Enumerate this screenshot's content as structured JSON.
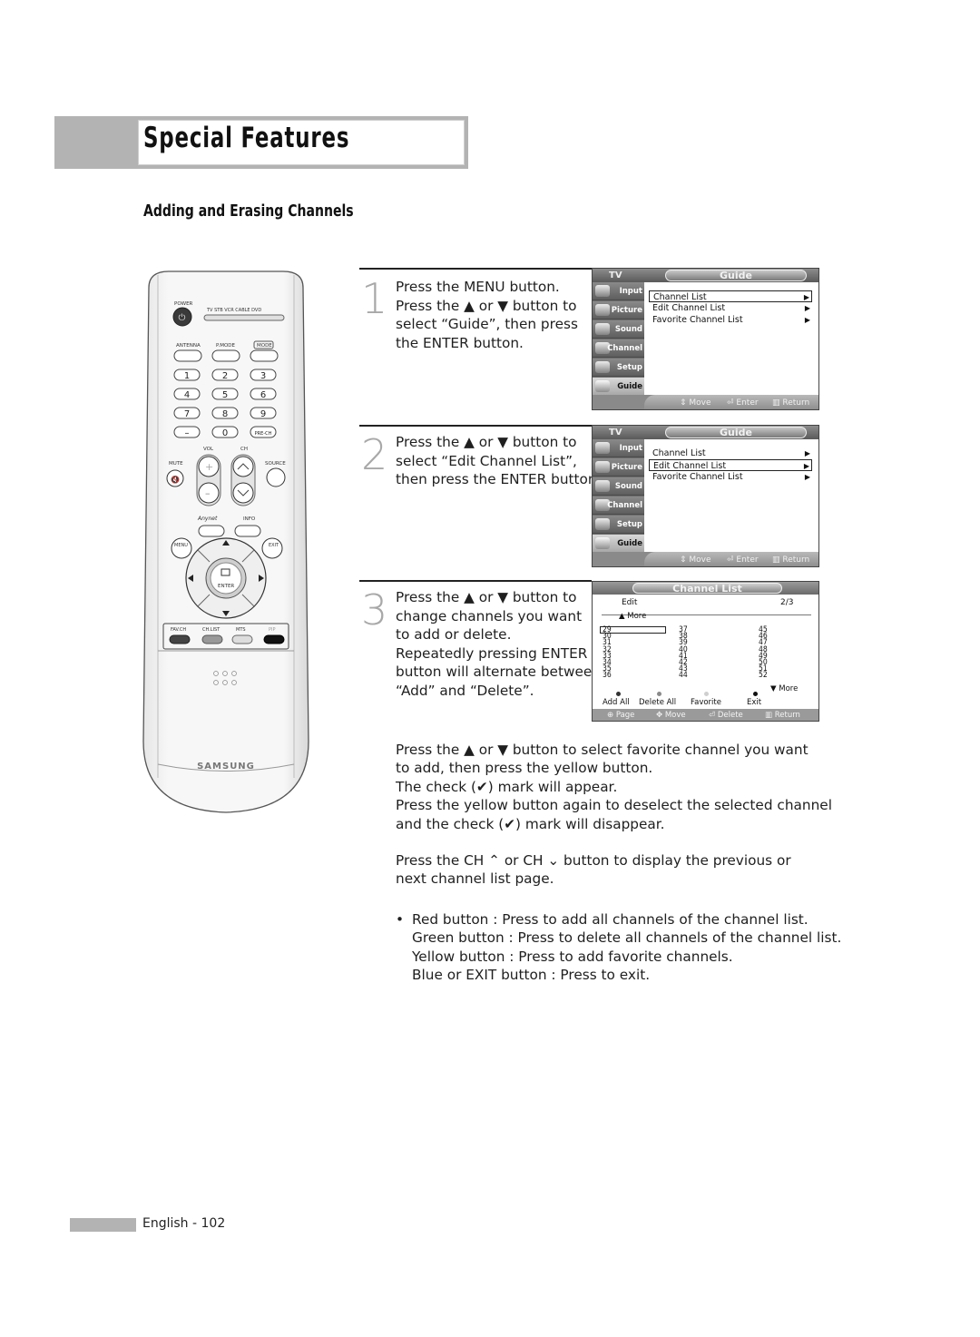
{
  "header": {
    "title": "Special Features",
    "section_title": "Adding and Erasing Channels"
  },
  "remote": {
    "labels": {
      "power": "POWER",
      "modes": "TV  STB  VCR  CABLE  DVD",
      "antenna": "ANTENNA",
      "pmode": "P.MODE",
      "mode": "MODE",
      "vol": "VOL",
      "ch": "CH",
      "mute": "MUTE",
      "source": "SOURCE",
      "anynet": "Anynet",
      "info": "INFO",
      "menu": "MENU",
      "exit": "EXIT",
      "enter": "ENTER",
      "favch": "FAV.CH",
      "chlist": "CH.LIST",
      "mts": "MTS",
      "pip": "PIP",
      "prech": "PRE-CH",
      "brand": "SAMSUNG"
    },
    "digits": [
      "1",
      "2",
      "3",
      "4",
      "5",
      "6",
      "7",
      "8",
      "9",
      "–",
      "0"
    ]
  },
  "steps": [
    {
      "number": "1",
      "lines": [
        "Press the MENU button.",
        "Press the ▲ or ▼ button to",
        "select “Guide”, then press",
        "the ENTER button."
      ]
    },
    {
      "number": "2",
      "lines": [
        "Press the ▲ or ▼ button to",
        "select “Edit Channel List”,",
        "then press the ENTER button."
      ]
    },
    {
      "number": "3",
      "lines": [
        "Press the ▲ or ▼ button to",
        "change channels you want",
        "to add or delete.",
        "Repeatedly pressing ENTER",
        "button will alternate between",
        "“Add” and “Delete”."
      ]
    }
  ],
  "osd_guide": {
    "tv_label": "TV",
    "title": "Guide",
    "sidebar": [
      "Input",
      "Picture",
      "Sound",
      "Channel",
      "Setup",
      "Guide"
    ],
    "items": [
      "Channel List",
      "Edit Channel List",
      "Favorite Channel List"
    ],
    "footer": {
      "move": "Move",
      "enter": "Enter",
      "return": "Return"
    }
  },
  "osd_channel_list": {
    "title": "Channel List",
    "mode": "Edit",
    "page": "2/3",
    "more_up": "▲ More",
    "more_down": "▼ More",
    "columns": [
      [
        "29",
        "30",
        "31",
        "32",
        "33",
        "34",
        "35",
        "36"
      ],
      [
        "37",
        "38",
        "39",
        "40",
        "41",
        "42",
        "43",
        "44"
      ],
      [
        "45",
        "46",
        "47",
        "48",
        "49",
        "50",
        "51",
        "52"
      ]
    ],
    "selected_channel": "29",
    "color_buttons": [
      {
        "label": "Add All",
        "color": "#333333"
      },
      {
        "label": "Delete All",
        "color": "#8a8a8a"
      },
      {
        "label": "Favorite",
        "color": "#cfcfcf"
      },
      {
        "label": "Exit",
        "color": "#111111"
      }
    ],
    "footer": {
      "page": "Page",
      "move": "Move",
      "delete": "Delete",
      "return": "Return"
    }
  },
  "body": {
    "favorite_paragraph": [
      "Press the ▲ or ▼ button to select favorite channel you want",
      "to add, then press the yellow button.",
      "The check (✔) mark will appear.",
      "Press the yellow button again to deselect the selected channel",
      "and the check (✔) mark will disappear."
    ],
    "ch_paragraph": [
      "Press the CH ⌃ or CH ⌄ button to display the previous or",
      "next channel list page."
    ],
    "bullets": [
      "Red button : Press to add all channels of the channel list.",
      "Green button : Press to delete all channels of the channel list.",
      "Yellow button : Press to add favorite channels.",
      "Blue or EXIT button : Press to exit."
    ]
  },
  "footer": {
    "page_label": "English - 102"
  }
}
